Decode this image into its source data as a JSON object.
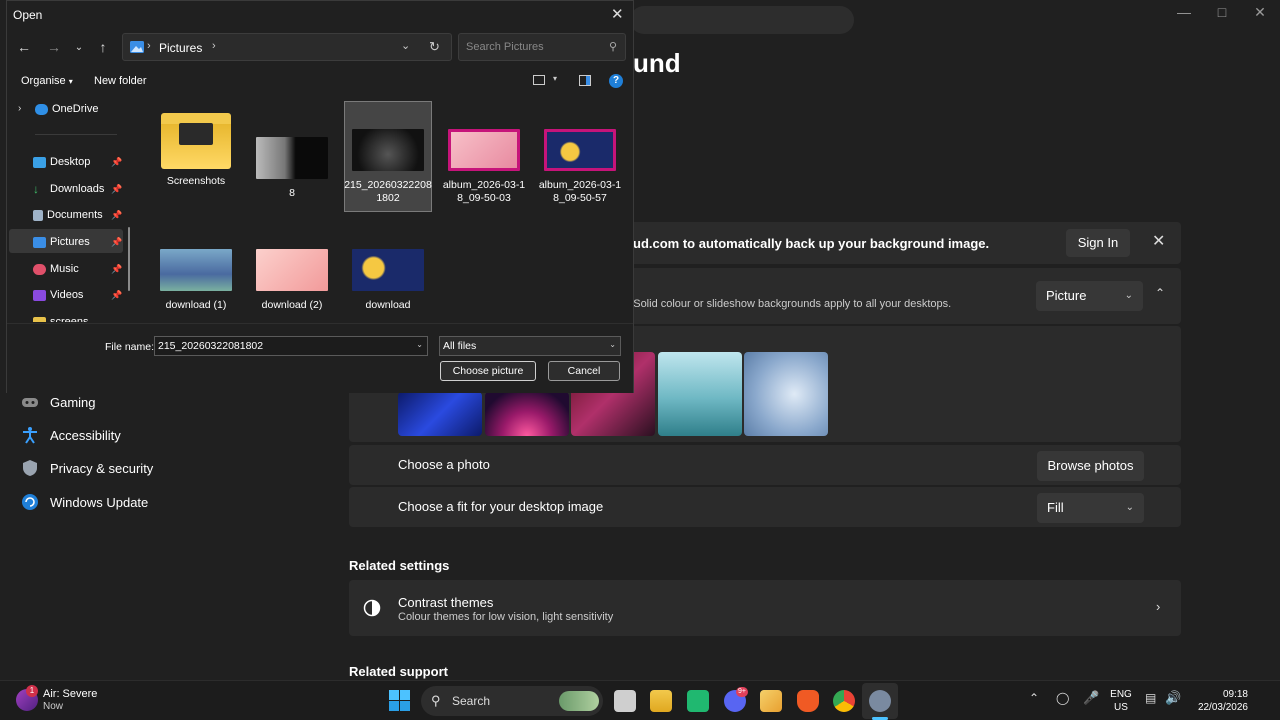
{
  "settings": {
    "page_title_partial": "und",
    "banner_text": "ud.com to automatically back up your background image.",
    "sign_in_label": "Sign In",
    "personalise_desc": "p. Solid colour or slideshow backgrounds apply to all your desktops.",
    "personalise_value": "Picture",
    "choose_photo_label": "Choose a photo",
    "browse_photos_label": "Browse photos",
    "choose_fit_label": "Choose a fit for your desktop image",
    "fit_value": "Fill",
    "related_settings": "Related settings",
    "contrast_title": "Contrast themes",
    "contrast_desc": "Colour themes for low vision, light sensitivity",
    "related_support": "Related support",
    "nav": [
      {
        "label": "Gaming",
        "icon": "gaming-icon"
      },
      {
        "label": "Accessibility",
        "icon": "accessibility-icon"
      },
      {
        "label": "Privacy & security",
        "icon": "shield-icon"
      },
      {
        "label": "Windows Update",
        "icon": "update-icon"
      }
    ]
  },
  "dialog": {
    "title": "Open",
    "breadcrumb": "Pictures",
    "search_placeholder": "Search Pictures",
    "organise": "Organise",
    "new_folder": "New folder",
    "sidebar": [
      {
        "label": "OneDrive",
        "icon": "cloud-icon"
      },
      {
        "label": "Desktop",
        "icon": "desktop-icon"
      },
      {
        "label": "Downloads",
        "icon": "download-icon"
      },
      {
        "label": "Documents",
        "icon": "document-icon"
      },
      {
        "label": "Pictures",
        "icon": "pictures-icon"
      },
      {
        "label": "Music",
        "icon": "music-icon"
      },
      {
        "label": "Videos",
        "icon": "video-icon"
      },
      {
        "label": "screens",
        "icon": "folder-icon"
      }
    ],
    "files": [
      {
        "name": "Screenshots"
      },
      {
        "name": "8"
      },
      {
        "name": "215_20260322081802",
        "line1": "215_20260322208",
        "line2": "1802"
      },
      {
        "name": "album_2026-03-18_09-50-03",
        "line1": "album_2026-03-1",
        "line2": "8_09-50-03"
      },
      {
        "name": "album_2026-03-18_09-50-57",
        "line1": "album_2026-03-1",
        "line2": "8_09-50-57"
      },
      {
        "name": "download (1)"
      },
      {
        "name": "download (2)"
      },
      {
        "name": "download"
      }
    ],
    "file_name_label": "File name:",
    "file_name_value": "215_20260322081802",
    "file_type_value": "All files",
    "choose_button": "Choose picture",
    "cancel_button": "Cancel"
  },
  "taskbar": {
    "weather_title": "Air: Severe",
    "weather_sub": "Now",
    "weather_badge": "1",
    "search_label": "Search",
    "discord_badge": "9+",
    "lang_line1": "ENG",
    "lang_line2": "US",
    "time": "09:18",
    "date": "22/03/2026"
  }
}
